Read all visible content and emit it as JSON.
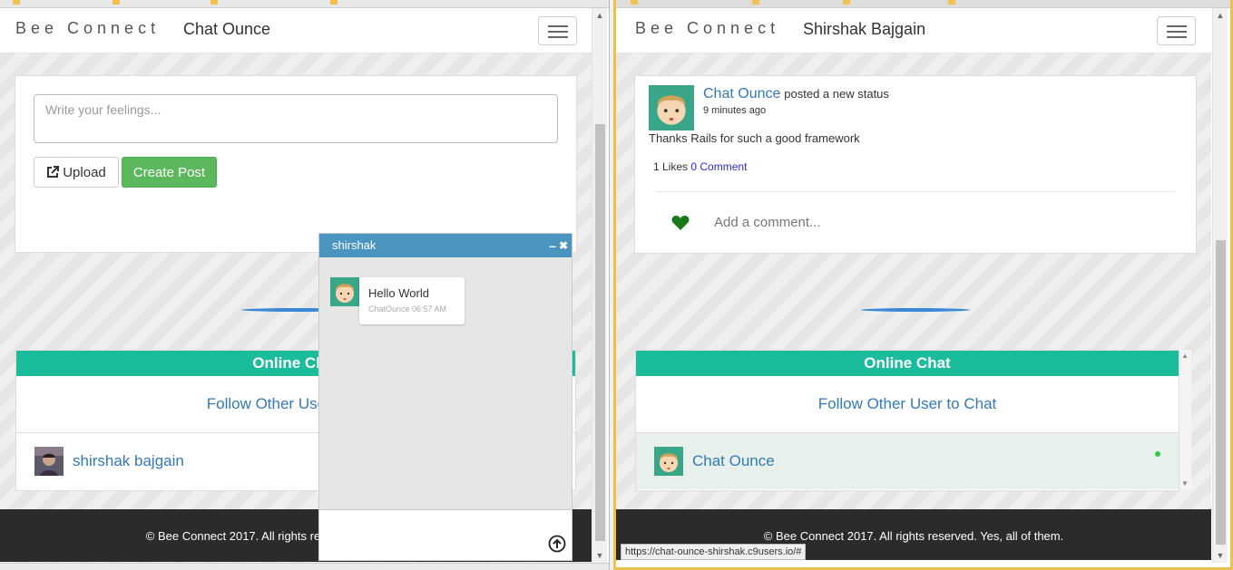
{
  "brand": "Bee Connect",
  "left": {
    "nav_user": "Chat Ounce",
    "post_placeholder": "Write your feelings...",
    "upload_label": "Upload",
    "create_post_label": "Create Post",
    "online_chat_title": "Online Chat",
    "follow_text": "Follow Other User to Chat",
    "online_user": "shirshak bajgain",
    "footer_text": "© Bee Connect 2017. All rights reserved. Yes, all of them."
  },
  "chat_window": {
    "title": "shirshak",
    "minimize_label": "–",
    "close_label": "✖",
    "messages": [
      {
        "text": "Hello World",
        "meta": "ChatOunce 06:57 AM"
      }
    ]
  },
  "right": {
    "nav_user": "Shirshak Bajgain",
    "post": {
      "author": "Chat Ounce",
      "action": "posted a new status",
      "time": "9 minutes ago",
      "body": "Thanks Rails for such a good framework",
      "likes": "1 Likes",
      "comments": "0 Comment",
      "comment_placeholder": "Add a comment..."
    },
    "online_chat_title": "Online Chat",
    "follow_text": "Follow Other User to Chat",
    "online_user": "Chat Ounce",
    "footer_text": "© Bee Connect 2017. All rights reserved. Yes, all of them.",
    "status_url": "https://chat-ounce-shirshak.c9users.io/#"
  },
  "colors": {
    "teal": "#1abc9c",
    "link": "#337ab7",
    "success": "#5cb85c",
    "chat_header": "#4a95c0",
    "footer": "#2b2b2b",
    "heart": "#1a7a1a",
    "online_dot": "#2ecc40"
  },
  "icons": [
    "external-link-icon",
    "hamburger-icon",
    "heart-icon",
    "upload-arrow-icon",
    "minimize-icon",
    "close-icon",
    "scroll-up-icon",
    "scroll-down-icon"
  ]
}
